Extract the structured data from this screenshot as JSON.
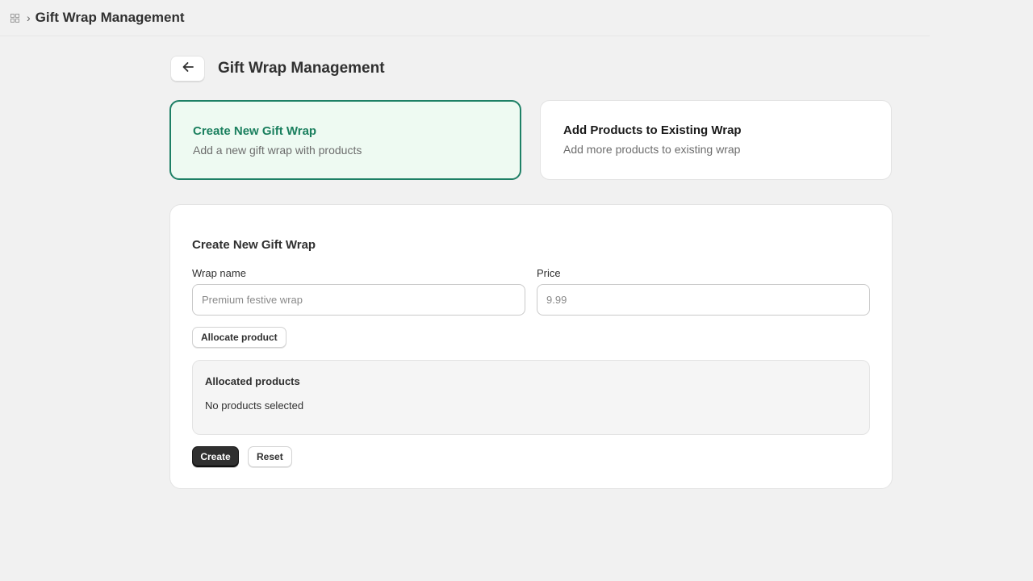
{
  "topbar": {
    "app_icon": "app-grid-icon",
    "separator": "›",
    "title": "Gift Wrap Management"
  },
  "header": {
    "back_icon": "arrow-left-icon",
    "title": "Gift Wrap Management"
  },
  "options": [
    {
      "title": "Create New Gift Wrap",
      "description": "Add a new gift wrap with products",
      "selected": true
    },
    {
      "title": "Add Products to Existing Wrap",
      "description": "Add more products to existing wrap",
      "selected": false
    }
  ],
  "form": {
    "title": "Create New Gift Wrap",
    "wrap_name": {
      "label": "Wrap name",
      "value": "",
      "placeholder": "Premium festive wrap"
    },
    "price": {
      "label": "Price",
      "value": "",
      "placeholder": "9.99"
    },
    "allocate_label": "Allocate product",
    "allocated": {
      "title": "Allocated products",
      "empty_text": "No products selected"
    },
    "create_label": "Create",
    "reset_label": "Reset"
  },
  "colors": {
    "accent_green": "#1e8066",
    "selected_bg": "#eefaf2",
    "primary_button": "#303030",
    "page_bg": "#f1f1f1"
  }
}
